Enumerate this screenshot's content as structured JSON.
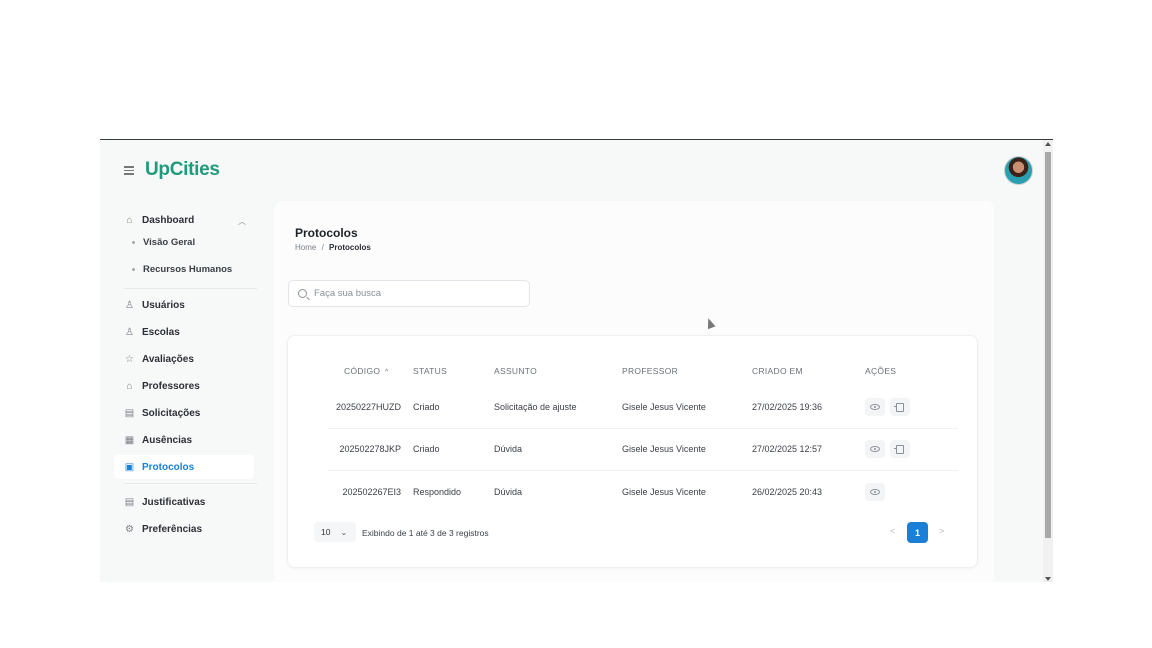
{
  "app": {
    "logo": "UpCities"
  },
  "sidebar": {
    "dashboard": {
      "label": "Dashboard",
      "sub": [
        "Visão Geral",
        "Recursos Humanos"
      ]
    },
    "items": [
      {
        "label": "Usuários",
        "icon": "user-icon"
      },
      {
        "label": "Escolas",
        "icon": "user-icon"
      },
      {
        "label": "Avaliações",
        "icon": "star-icon"
      },
      {
        "label": "Professores",
        "icon": "graduation-cap-icon"
      },
      {
        "label": "Solicitações",
        "icon": "document-icon"
      },
      {
        "label": "Ausências",
        "icon": "calendar-icon"
      },
      {
        "label": "Protocolos",
        "icon": "protocol-icon",
        "active": true
      },
      {
        "label": "Justificativas",
        "icon": "document-icon"
      },
      {
        "label": "Preferências",
        "icon": "gear-icon"
      }
    ]
  },
  "page": {
    "title": "Protocolos",
    "breadcrumb": {
      "home": "Home",
      "sep": "/",
      "current": "Protocolos"
    }
  },
  "search": {
    "placeholder": "Faça sua busca",
    "value": ""
  },
  "table": {
    "columns": [
      "CÓDIGO",
      "STATUS",
      "ASSUNTO",
      "PROFESSOR",
      "CRIADO EM",
      "AÇÕES"
    ],
    "sort_indicator": "^",
    "rows": [
      {
        "code": "20250227HUZD",
        "status": "Criado",
        "subject": "Solicitação de ajuste",
        "teacher": "Gisele Jesus Vicente",
        "created": "27/02/2025 19:36",
        "actions": [
          "view",
          "edit"
        ]
      },
      {
        "code": "202502278JKP",
        "status": "Criado",
        "subject": "Dúvida",
        "teacher": "Gisele Jesus Vicente",
        "created": "27/02/2025 12:57",
        "actions": [
          "view",
          "edit"
        ]
      },
      {
        "code": "202502267EI3",
        "status": "Respondido",
        "subject": "Dúvida",
        "teacher": "Gisele Jesus Vicente",
        "created": "26/02/2025 20:43",
        "actions": [
          "view"
        ]
      }
    ]
  },
  "pagination": {
    "page_size": "10",
    "info": "Exibindo de 1 até 3 de 3 registros",
    "prev": "<",
    "current": "1",
    "next": ">"
  },
  "colors": {
    "brand": "#1f9a7a",
    "accent": "#1a7fd6"
  }
}
